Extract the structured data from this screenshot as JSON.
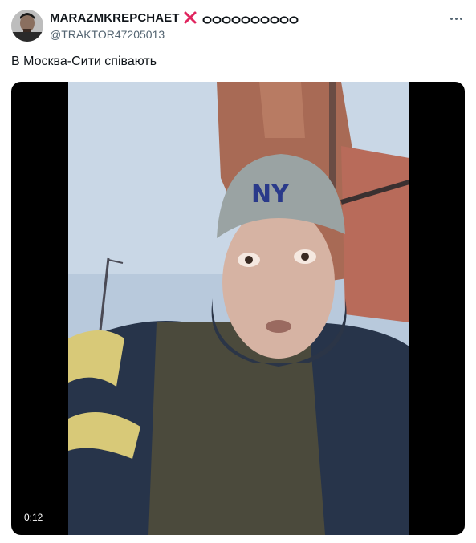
{
  "tweet": {
    "author": {
      "display_name": "MARAZMKREPCHAET",
      "handle": "@TRAKTOR47205013",
      "avatar_icon": "profile-photo",
      "name_decorations": [
        "cross-mark-icon",
        "loop-icon"
      ]
    },
    "text": "В Москва-Сити співають",
    "media": {
      "type": "video",
      "duration_label": "0:12"
    },
    "menu_icon": "more-horizontal-icon"
  },
  "colors": {
    "cross": "#e0245e",
    "handle": "#536471",
    "text": "#0f1419",
    "media_bg": "#000000"
  }
}
